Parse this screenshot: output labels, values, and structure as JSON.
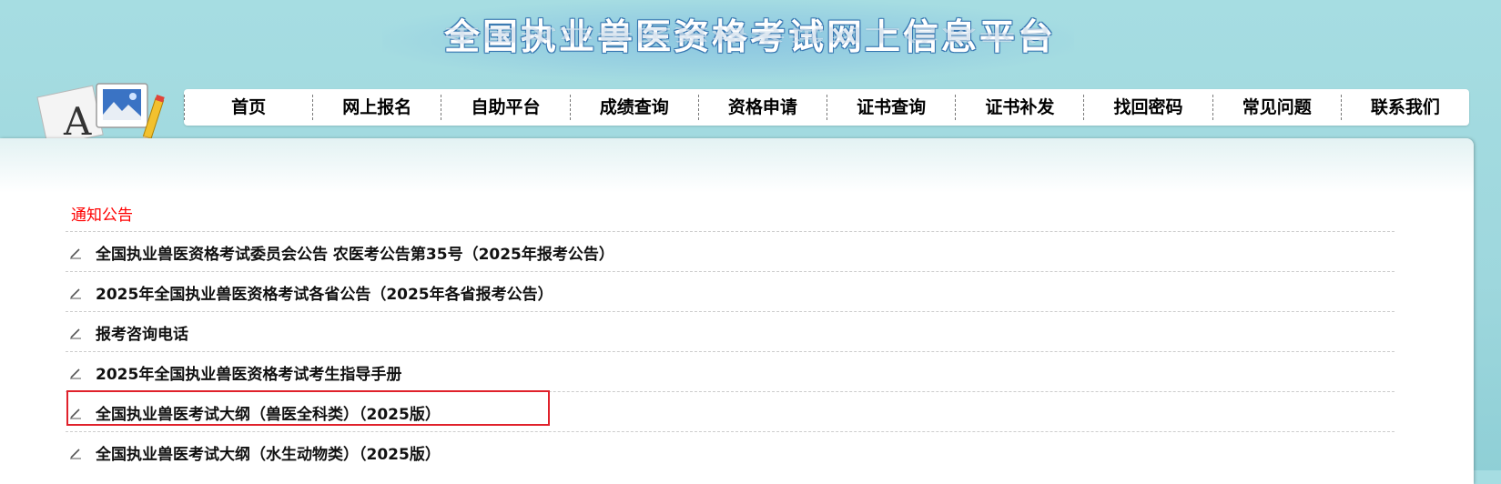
{
  "header": {
    "site_title": "全国执业兽医资格考试网上信息平台"
  },
  "nav": {
    "items": [
      {
        "label": "首页"
      },
      {
        "label": "网上报名"
      },
      {
        "label": "自助平台"
      },
      {
        "label": "成绩查询"
      },
      {
        "label": "资格申请"
      },
      {
        "label": "证书查询"
      },
      {
        "label": "证书补发"
      },
      {
        "label": "找回密码"
      },
      {
        "label": "常见问题"
      },
      {
        "label": "联系我们"
      }
    ]
  },
  "notices": {
    "section_title": "通知公告",
    "items": [
      {
        "title": "全国执业兽医资格考试委员会公告 农医考公告第35号（2025年报考公告）"
      },
      {
        "title": "2025年全国执业兽医资格考试各省公告（2025年各省报考公告）"
      },
      {
        "title": "报考咨询电话"
      },
      {
        "title": "2025年全国执业兽医资格考试考生指导手册"
      },
      {
        "title": "全国执业兽医考试大纲（兽医全科类）（2025版）"
      },
      {
        "title": "全国执业兽医考试大纲（水生动物类）（2025版）"
      }
    ]
  },
  "colors": {
    "background": "#a6dde2",
    "section_title": "#ff0000",
    "highlight_border": "#e0212b"
  },
  "icons": {
    "logo": "picture-frame-letter-a-pencil-icon",
    "list_bullet": "pencil-icon"
  }
}
